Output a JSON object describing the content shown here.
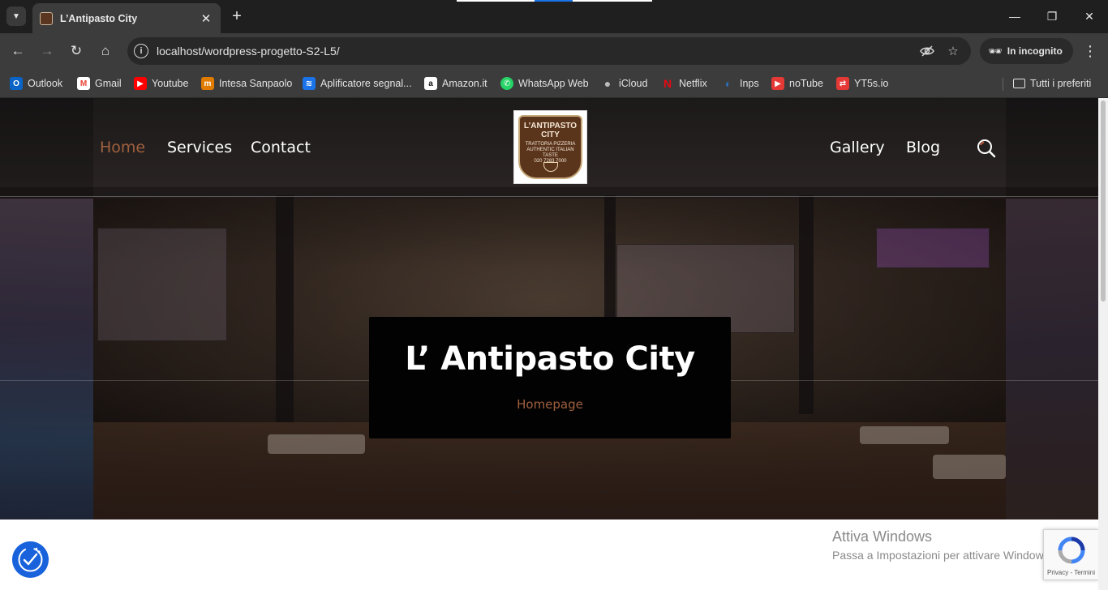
{
  "browser": {
    "tab_title": "L’Antipasto City",
    "url": "localhost/wordpress-progetto-S2-L5/",
    "incognito_label": "In incognito",
    "bookmarks": [
      {
        "label": "Outlook",
        "icon": "outlook-icon",
        "color": "#0a64c8"
      },
      {
        "label": "Gmail",
        "icon": "gmail-icon",
        "color": "#ea4335"
      },
      {
        "label": "Youtube",
        "icon": "youtube-icon",
        "color": "#ff0000"
      },
      {
        "label": "Intesa Sanpaolo",
        "icon": "intesa-icon",
        "color": "#e07b00"
      },
      {
        "label": "Aplificatore segnal...",
        "icon": "wifi-icon",
        "color": "#1a73e8"
      },
      {
        "label": "Amazon.it",
        "icon": "amazon-icon",
        "color": "#ffffff"
      },
      {
        "label": "WhatsApp Web",
        "icon": "whatsapp-icon",
        "color": "#25d366"
      },
      {
        "label": "iCloud",
        "icon": "apple-icon",
        "color": "#bbbbbb"
      },
      {
        "label": "Netflix",
        "icon": "netflix-icon",
        "color": "#e50914"
      },
      {
        "label": "Inps",
        "icon": "inps-icon",
        "color": "#2b6fb5"
      },
      {
        "label": "noTube",
        "icon": "notube-icon",
        "color": "#e53935"
      },
      {
        "label": "YT5s.io",
        "icon": "yt5s-icon",
        "color": "#e53935"
      }
    ],
    "all_bookmarks_label": "Tutti i preferiti"
  },
  "site": {
    "nav_left": [
      "Home",
      "Services",
      "Contact"
    ],
    "nav_right": [
      "Gallery",
      "Blog"
    ],
    "logo": {
      "name": "L’ANTIPASTO CITY",
      "line1": "TRATTORIA PIZZERIA",
      "line2": "AUTHENTIC ITALIAN TASTE",
      "phone": "020 7283 7000"
    },
    "page_title": "L’ Antipasto City",
    "breadcrumb": "Homepage",
    "accent_color": "#a0603f"
  },
  "overlay": {
    "activate_title": "Attiva Windows",
    "activate_sub": "Passa a Impostazioni per attivare Windows.",
    "recaptcha_links": "Privacy - Termini"
  }
}
